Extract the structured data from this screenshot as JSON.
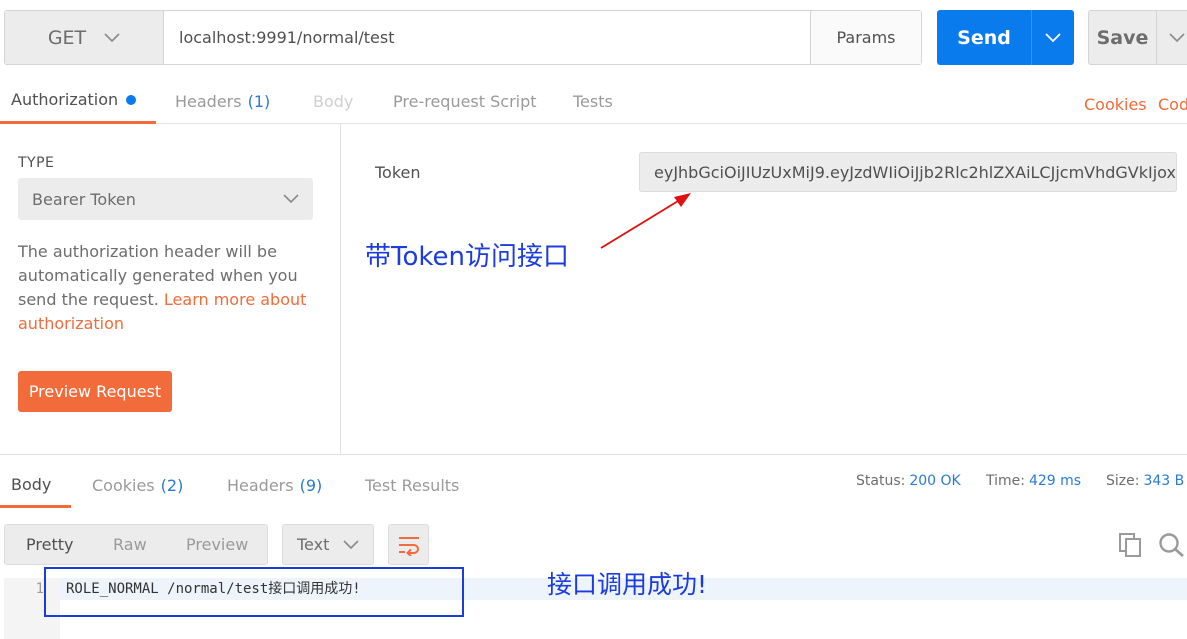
{
  "request": {
    "method": "GET",
    "url": "localhost:9991/normal/test",
    "params_label": "Params",
    "send_label": "Send",
    "save_label": "Save"
  },
  "request_tabs": {
    "authorization": "Authorization",
    "headers": "Headers",
    "headers_count": "(1)",
    "body": "Body",
    "pre_request": "Pre-request Script",
    "tests": "Tests",
    "cookies": "Cookies",
    "code": "Code"
  },
  "auth": {
    "type_label": "TYPE",
    "type_value": "Bearer Token",
    "description": "The authorization header will be automatically generated when you send the request.",
    "learn_more": "Learn more about authorization",
    "preview_button": "Preview Request",
    "token_label": "Token",
    "token_value": "eyJhbGciOiJIUzUxMiJ9.eyJzdWIiOiJjb2Rlc2hlZXAiLCJjcmVhdGVkIjox..."
  },
  "annotations": {
    "token_note": "带Token访问接口",
    "result_note": "接口调用成功!"
  },
  "response_tabs": {
    "body": "Body",
    "cookies": "Cookies",
    "cookies_count": "(2)",
    "headers": "Headers",
    "headers_count": "(9)",
    "test_results": "Test Results"
  },
  "response_status": {
    "status_label": "Status:",
    "status_value": "200 OK",
    "time_label": "Time:",
    "time_value": "429 ms",
    "size_label": "Size:",
    "size_value": "343 B"
  },
  "response_view": {
    "pretty": "Pretty",
    "raw": "Raw",
    "preview": "Preview",
    "format": "Text"
  },
  "response_body": {
    "line_number": "1",
    "text": "ROLE_NORMAL /normal/test接口调用成功!"
  },
  "colors": {
    "accent_orange": "#f26b3a",
    "send_blue": "#097bed",
    "annotation_blue": "#1c3ce0",
    "arrow_red": "#e01010"
  }
}
